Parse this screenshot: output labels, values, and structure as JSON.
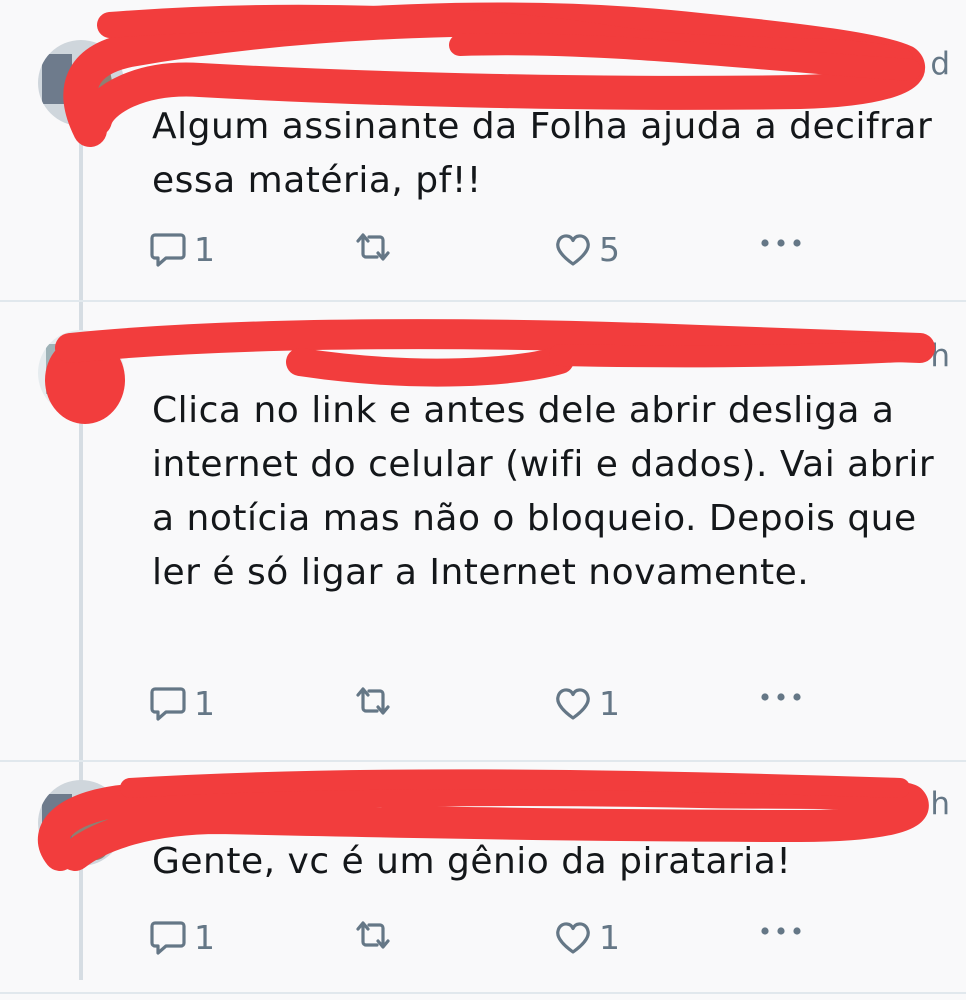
{
  "tweets": [
    {
      "time": "d",
      "text": "Algum assinante da Folha ajuda a decifrar essa matéria, pf!!",
      "replies": "1",
      "likes": "5"
    },
    {
      "time": "h",
      "text": "Clica no link e antes dele abrir desliga a internet do celular (wifi e dados). Vai abrir a notícia mas não o bloqueio. Depois que ler é só ligar a Internet novamente.",
      "replies": "1",
      "likes": "1"
    },
    {
      "time": "h",
      "text": "Gente, vc é um gênio da pirataria!",
      "replies": "1",
      "likes": "1"
    }
  ],
  "icons": {
    "reply": "reply-icon",
    "retweet": "retweet-icon",
    "like": "heart-icon",
    "more": "more-dots-icon"
  },
  "colors": {
    "redaction": "#f23d3d",
    "icon": "#657786",
    "thread": "#d6dde3"
  }
}
